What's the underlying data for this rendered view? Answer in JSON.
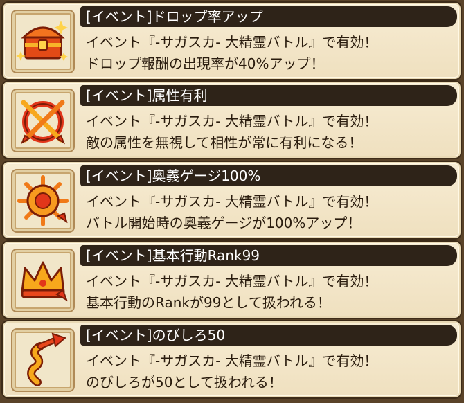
{
  "effects": [
    {
      "title": "[イベント]ドロップ率アップ",
      "line1": "イベント『-サガスカ- 大精霊バトル』で有効！",
      "line2": "ドロップ報酬の出現率が40%アップ！",
      "icon": "treasure-chest-icon",
      "accent": "#e8471c"
    },
    {
      "title": "[イベント]属性有利",
      "line1": "イベント『-サガスカ- 大精霊バトル』で有効！",
      "line2": "敵の属性を無視して相性が常に有利になる！",
      "icon": "crossed-arrows-icon",
      "accent": "#e8471c"
    },
    {
      "title": "[イベント]奥義ゲージ100%",
      "line1": "イベント『-サガスカ- 大精霊バトル』で有効！",
      "line2": "バトル開始時の奥義ゲージが100%アップ！",
      "icon": "burst-wheel-icon",
      "accent": "#f07a18"
    },
    {
      "title": "[イベント]基本行動Rank99",
      "line1": "イベント『-サガスカ- 大精霊バトル』で有効！",
      "line2": "基本行動のRankが99として扱われる！",
      "icon": "crown-icon",
      "accent": "#f5a013"
    },
    {
      "title": "[イベント]のびしろ50",
      "line1": "イベント『-サガスカ- 大精霊バトル』で有効！",
      "line2": "のびしろが50として扱われる！",
      "icon": "spiral-arrow-icon",
      "accent": "#e8471c"
    }
  ]
}
